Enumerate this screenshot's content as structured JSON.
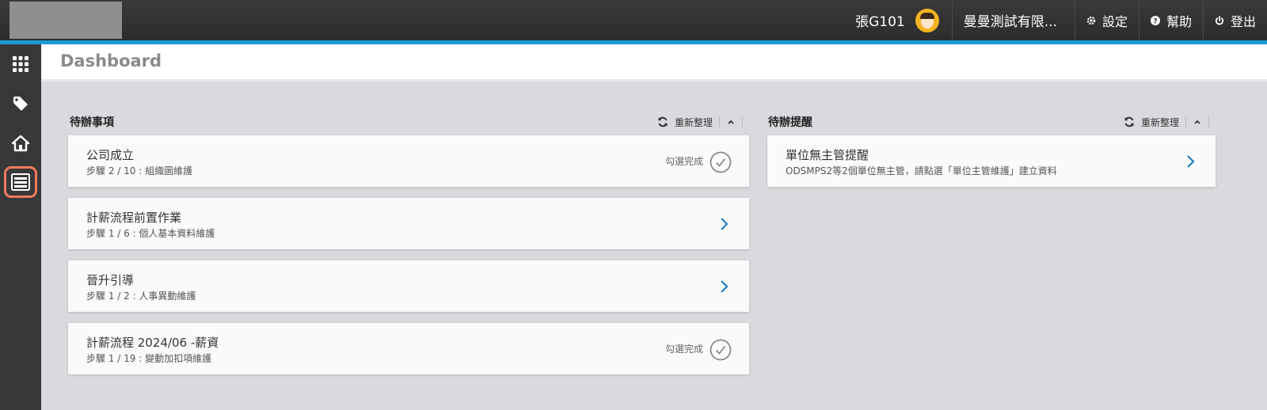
{
  "topbar": {
    "user_name": "張G101",
    "company": "曼曼測試有限...",
    "links": [
      {
        "label": "設定",
        "icon": "gear-icon"
      },
      {
        "label": "幫助",
        "icon": "help-icon"
      },
      {
        "label": "登出",
        "icon": "power-icon"
      }
    ]
  },
  "colors": {
    "accent": "#1a9ad6",
    "active_highlight": "#f07a5c",
    "chevron": "#1f7fc4"
  },
  "sidebar": {
    "items": [
      {
        "icon": "apps-grid-icon"
      },
      {
        "icon": "tag-icon"
      },
      {
        "icon": "home-icon"
      },
      {
        "icon": "list-panel-icon",
        "active": true
      }
    ]
  },
  "header": {
    "title": "Dashboard"
  },
  "todo": {
    "title": "待辦事項",
    "refresh_label": "重新整理",
    "items": [
      {
        "title": "公司成立",
        "step": "步驟 2 / 10 : 組織圖維護",
        "action": "勾選完成",
        "type": "check"
      },
      {
        "title": "計薪流程前置作業",
        "step": "步驟 1 / 6 : 個人基本資料維護",
        "type": "chevron"
      },
      {
        "title": "晉升引導",
        "step": "步驟 1 / 2 : 人事異動維護",
        "type": "chevron"
      },
      {
        "title": "計薪流程 2024/06 -薪資",
        "step": "步驟 1 / 19 : 變動加扣項維護",
        "action": "勾選完成",
        "type": "check"
      }
    ]
  },
  "reminders": {
    "title": "待辦提醒",
    "refresh_label": "重新整理",
    "items": [
      {
        "title": "單位無主管提醒",
        "detail": "ODSMPS2等2個單位無主管，請點選「單位主管維護」建立資料",
        "type": "chevron"
      }
    ]
  }
}
